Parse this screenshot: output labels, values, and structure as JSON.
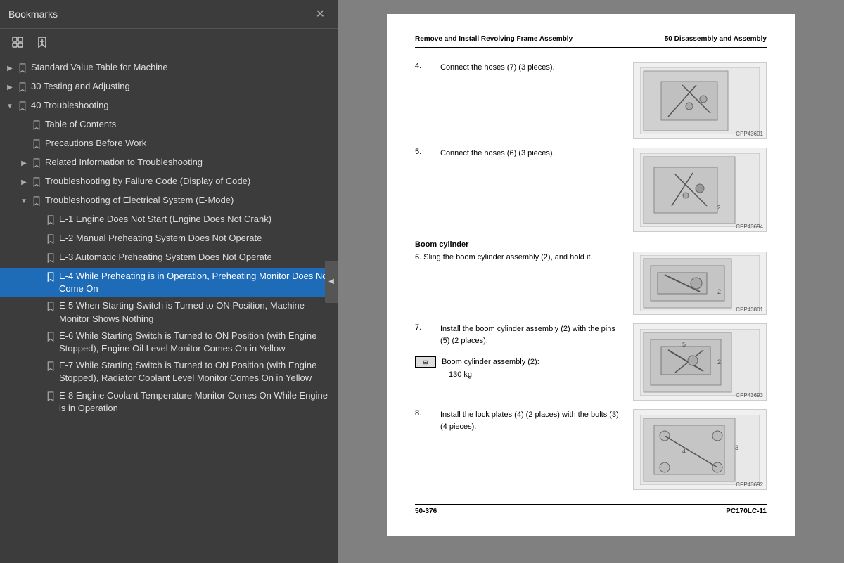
{
  "panel": {
    "title": "Bookmarks",
    "close_label": "✕"
  },
  "toolbar": {
    "grid_icon": "⊞",
    "bookmark_icon": "🔖"
  },
  "tree": [
    {
      "id": "standard-value",
      "level": 0,
      "expandable": true,
      "expanded": false,
      "label": "Standard Value Table for Machine",
      "selected": false
    },
    {
      "id": "30-testing",
      "level": 0,
      "expandable": true,
      "expanded": false,
      "label": "30 Testing and Adjusting",
      "selected": false
    },
    {
      "id": "40-troubleshooting",
      "level": 0,
      "expandable": true,
      "expanded": true,
      "label": "40 Troubleshooting",
      "selected": false
    },
    {
      "id": "table-of-contents",
      "level": 1,
      "expandable": false,
      "expanded": false,
      "label": "Table of Contents",
      "selected": false
    },
    {
      "id": "precautions-before-work",
      "level": 1,
      "expandable": false,
      "expanded": false,
      "label": "Precautions Before Work",
      "selected": false
    },
    {
      "id": "related-info",
      "level": 1,
      "expandable": true,
      "expanded": false,
      "label": "Related Information to Troubleshooting",
      "selected": false
    },
    {
      "id": "failure-code",
      "level": 1,
      "expandable": true,
      "expanded": false,
      "label": "Troubleshooting by Failure Code (Display of Code)",
      "selected": false
    },
    {
      "id": "electrical-system",
      "level": 1,
      "expandable": true,
      "expanded": true,
      "label": "Troubleshooting of Electrical System (E-Mode)",
      "selected": false
    },
    {
      "id": "e1",
      "level": 2,
      "expandable": false,
      "expanded": false,
      "label": "E-1 Engine Does Not Start (Engine Does Not Crank)",
      "selected": false
    },
    {
      "id": "e2",
      "level": 2,
      "expandable": false,
      "expanded": false,
      "label": "E-2 Manual Preheating System Does Not Operate",
      "selected": false
    },
    {
      "id": "e3",
      "level": 2,
      "expandable": false,
      "expanded": false,
      "label": "E-3 Automatic Preheating System Does Not Operate",
      "selected": false
    },
    {
      "id": "e4",
      "level": 2,
      "expandable": false,
      "expanded": false,
      "label": "E-4 While Preheating is in Operation, Preheating Monitor Does Not Come On",
      "selected": true
    },
    {
      "id": "e5",
      "level": 2,
      "expandable": false,
      "expanded": false,
      "label": "E-5 When Starting Switch is Turned to ON Position, Machine Monitor Shows Nothing",
      "selected": false
    },
    {
      "id": "e6",
      "level": 2,
      "expandable": false,
      "expanded": false,
      "label": "E-6 While Starting Switch is Turned to ON Position (with Engine Stopped), Engine Oil Level Monitor Comes On in Yellow",
      "selected": false
    },
    {
      "id": "e7",
      "level": 2,
      "expandable": false,
      "expanded": false,
      "label": "E-7 While Starting Switch is Turned to ON Position (with Engine Stopped), Radiator Coolant Level Monitor Comes On in Yellow",
      "selected": false
    },
    {
      "id": "e8",
      "level": 2,
      "expandable": false,
      "expanded": false,
      "label": "E-8 Engine Coolant Temperature Monitor Comes On While Engine is in Operation",
      "selected": false
    }
  ],
  "pdf": {
    "header_left": "Remove and Install Revolving Frame Assembly",
    "header_right": "50 Disassembly and Assembly",
    "steps": [
      {
        "num": "4.",
        "text": "Connect the hoses (7) (3 pieces).",
        "img_id": "CPP43601"
      },
      {
        "num": "5.",
        "text": "Connect the hoses (6) (3 pieces).",
        "img_id": "CPP43694"
      }
    ],
    "boom_cylinder_heading": "Boom cylinder",
    "step6": "6.   Sling the boom cylinder assembly (2), and hold it.",
    "step6_img": "CPP43801",
    "step7_num": "7.",
    "step7_text": "Install the boom cylinder assembly (2) with the pins (5) (2 places).",
    "spec_label": "Boom cylinder assembly (2):",
    "spec_value": "130 kg",
    "step7_img": "CPP43693",
    "step8_num": "8.",
    "step8_text": "Install the lock plates (4) (2 places) with the bolts (3) (4 pieces).",
    "step8_img": "CPP43692",
    "footer_left": "50-376",
    "footer_right": "PC170LC-11"
  }
}
